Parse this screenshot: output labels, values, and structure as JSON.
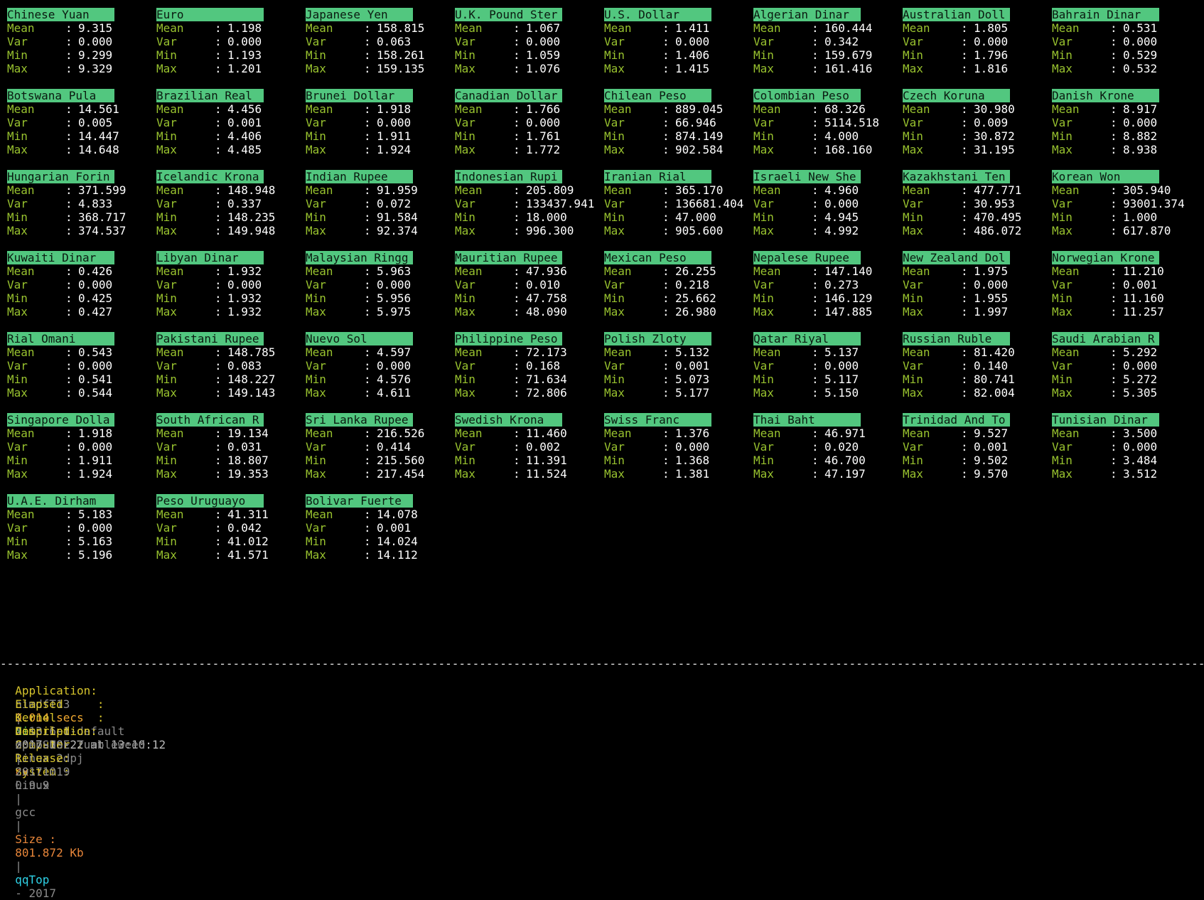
{
  "labels": {
    "mean": "Mean",
    "var": "Var",
    "min": "Min",
    "max": "Max",
    "colon": ":"
  },
  "currencies": [
    {
      "name": "Chinese Yuan",
      "mean": "9.315",
      "var": "0.000",
      "min": "9.299",
      "max": "9.329"
    },
    {
      "name": "Euro",
      "mean": "1.198",
      "var": "0.000",
      "min": "1.193",
      "max": "1.201"
    },
    {
      "name": "Japanese Yen",
      "mean": "158.815",
      "var": "0.063",
      "min": "158.261",
      "max": "159.135"
    },
    {
      "name": "U.K. Pound Ster",
      "mean": "1.067",
      "var": "0.000",
      "min": "1.059",
      "max": "1.076"
    },
    {
      "name": "U.S. Dollar",
      "mean": "1.411",
      "var": "0.000",
      "min": "1.406",
      "max": "1.415"
    },
    {
      "name": "Algerian Dinar",
      "mean": "160.444",
      "var": "0.342",
      "min": "159.679",
      "max": "161.416"
    },
    {
      "name": "Australian Doll",
      "mean": "1.805",
      "var": "0.000",
      "min": "1.796",
      "max": "1.816"
    },
    {
      "name": "Bahrain Dinar",
      "mean": "0.531",
      "var": "0.000",
      "min": "0.529",
      "max": "0.532"
    },
    {
      "name": "Botswana Pula",
      "mean": "14.561",
      "var": "0.005",
      "min": "14.447",
      "max": "14.648"
    },
    {
      "name": "Brazilian Real",
      "mean": "4.456",
      "var": "0.001",
      "min": "4.406",
      "max": "4.485"
    },
    {
      "name": "Brunei Dollar",
      "mean": "1.918",
      "var": "0.000",
      "min": "1.911",
      "max": "1.924"
    },
    {
      "name": "Canadian Dollar",
      "mean": "1.766",
      "var": "0.000",
      "min": "1.761",
      "max": "1.772"
    },
    {
      "name": "Chilean Peso",
      "mean": "889.045",
      "var": "66.946",
      "min": "874.149",
      "max": "902.584"
    },
    {
      "name": "Colombian Peso",
      "mean": "68.326",
      "var": "5114.518",
      "min": "4.000",
      "max": "168.160"
    },
    {
      "name": "Czech Koruna",
      "mean": "30.980",
      "var": "0.009",
      "min": "30.872",
      "max": "31.195"
    },
    {
      "name": "Danish Krone",
      "mean": "8.917",
      "var": "0.000",
      "min": "8.882",
      "max": "8.938"
    },
    {
      "name": "Hungarian Forin",
      "mean": "371.599",
      "var": "4.833",
      "min": "368.717",
      "max": "374.537"
    },
    {
      "name": "Icelandic Krona",
      "mean": "148.948",
      "var": "0.337",
      "min": "148.235",
      "max": "149.948"
    },
    {
      "name": "Indian Rupee",
      "mean": "91.959",
      "var": "0.072",
      "min": "91.584",
      "max": "92.374"
    },
    {
      "name": "Indonesian Rupi",
      "mean": "205.809",
      "var": "133437.941",
      "min": "18.000",
      "max": "996.300"
    },
    {
      "name": "Iranian Rial",
      "mean": "365.170",
      "var": "136681.404",
      "min": "47.000",
      "max": "905.600"
    },
    {
      "name": "Israeli New She",
      "mean": "4.960",
      "var": "0.000",
      "min": "4.945",
      "max": "4.992"
    },
    {
      "name": "Kazakhstani Ten",
      "mean": "477.771",
      "var": "30.953",
      "min": "470.495",
      "max": "486.072"
    },
    {
      "name": "Korean Won",
      "mean": "305.940",
      "var": "93001.374",
      "min": "1.000",
      "max": "617.870"
    },
    {
      "name": "Kuwaiti Dinar",
      "mean": "0.426",
      "var": "0.000",
      "min": "0.425",
      "max": "0.427"
    },
    {
      "name": "Libyan Dinar",
      "mean": "1.932",
      "var": "0.000",
      "min": "1.932",
      "max": "1.932"
    },
    {
      "name": "Malaysian Ringg",
      "mean": "5.963",
      "var": "0.000",
      "min": "5.956",
      "max": "5.975"
    },
    {
      "name": "Mauritian Rupee",
      "mean": "47.936",
      "var": "0.010",
      "min": "47.758",
      "max": "48.090"
    },
    {
      "name": "Mexican Peso",
      "mean": "26.255",
      "var": "0.218",
      "min": "25.662",
      "max": "26.980"
    },
    {
      "name": "Nepalese Rupee",
      "mean": "147.140",
      "var": "0.273",
      "min": "146.129",
      "max": "147.885"
    },
    {
      "name": "New Zealand Dol",
      "mean": "1.975",
      "var": "0.000",
      "min": "1.955",
      "max": "1.997"
    },
    {
      "name": "Norwegian Krone",
      "mean": "11.210",
      "var": "0.001",
      "min": "11.160",
      "max": "11.257"
    },
    {
      "name": "Rial Omani",
      "mean": "0.543",
      "var": "0.000",
      "min": "0.541",
      "max": "0.544"
    },
    {
      "name": "Pakistani Rupee",
      "mean": "148.785",
      "var": "0.083",
      "min": "148.227",
      "max": "149.143"
    },
    {
      "name": "Nuevo Sol",
      "mean": "4.597",
      "var": "0.000",
      "min": "4.576",
      "max": "4.611"
    },
    {
      "name": "Philippine Peso",
      "mean": "72.173",
      "var": "0.168",
      "min": "71.634",
      "max": "72.806"
    },
    {
      "name": "Polish Zloty",
      "mean": "5.132",
      "var": "0.001",
      "min": "5.073",
      "max": "5.177"
    },
    {
      "name": "Qatar Riyal",
      "mean": "5.137",
      "var": "0.000",
      "min": "5.117",
      "max": "5.150"
    },
    {
      "name": "Russian Ruble",
      "mean": "81.420",
      "var": "0.140",
      "min": "80.741",
      "max": "82.004"
    },
    {
      "name": "Saudi Arabian R",
      "mean": "5.292",
      "var": "0.000",
      "min": "5.272",
      "max": "5.305"
    },
    {
      "name": "Singapore Dolla",
      "mean": "1.918",
      "var": "0.000",
      "min": "1.911",
      "max": "1.924"
    },
    {
      "name": "South African R",
      "mean": "19.134",
      "var": "0.031",
      "min": "18.807",
      "max": "19.353"
    },
    {
      "name": "Sri Lanka Rupee",
      "mean": "216.526",
      "var": "0.414",
      "min": "215.560",
      "max": "217.454"
    },
    {
      "name": "Swedish Krona",
      "mean": "11.460",
      "var": "0.002",
      "min": "11.391",
      "max": "11.524"
    },
    {
      "name": "Swiss Franc",
      "mean": "1.376",
      "var": "0.000",
      "min": "1.368",
      "max": "1.381"
    },
    {
      "name": "Thai Baht",
      "mean": "46.971",
      "var": "0.020",
      "min": "46.700",
      "max": "47.197"
    },
    {
      "name": "Trinidad And To",
      "mean": "9.527",
      "var": "0.001",
      "min": "9.502",
      "max": "9.570"
    },
    {
      "name": "Tunisian Dinar",
      "mean": "3.500",
      "var": "0.000",
      "min": "3.484",
      "max": "3.512"
    },
    {
      "name": "U.A.E. Dirham",
      "mean": "5.183",
      "var": "0.000",
      "min": "5.163",
      "max": "5.196"
    },
    {
      "name": "Peso Uruguayo",
      "mean": "41.311",
      "var": "0.042",
      "min": "41.012",
      "max": "41.571"
    },
    {
      "name": "Bolivar Fuerte",
      "mean": "14.078",
      "var": "0.001",
      "min": "14.024",
      "max": "14.112"
    }
  ],
  "footer": {
    "separator": "-----------------------------------------------------------------------------------------------------------------------------------------------------------------------------------",
    "application": {
      "label": "Application:",
      "app_name": "nimdfT13",
      "pipe": "|",
      "nim_label": "Nim :",
      "nim_version": "0.17.3",
      "cx_label": "cx :",
      "cx_version": "0.9.9",
      "compiler": "gcc",
      "size_label": "Size :",
      "size_value": "801.872 Kb",
      "brand_qq": "qq",
      "brand_top": "Top",
      "year": "- 2017"
    },
    "elapsed": {
      "label": "Elapsed     :",
      "value": "0.014 secs",
      "compiled_label": "Compiled on:",
      "compiled_value": "2017-10-22 at 13:10:12"
    },
    "kernel": {
      "label": "Kernel      :",
      "value": "4.13.6-1-default",
      "computer_label": "Computer :",
      "computer_value": "linux-2dpj",
      "system_label": "System :",
      "system_value": "Linux"
    },
    "description": {
      "label": "Description:",
      "value": "openSUSE Tumbleweed",
      "release_label": "Release:",
      "release_value": "20171019"
    }
  },
  "colors": {
    "background": "#000000",
    "header_bg": "#52c77f",
    "stat_label": "#99c32f",
    "value": "#ffffff",
    "footer_label": "#d6c42c",
    "nim": "#62d94a",
    "cx": "#e8863a",
    "brand": "#2fd3e8"
  }
}
